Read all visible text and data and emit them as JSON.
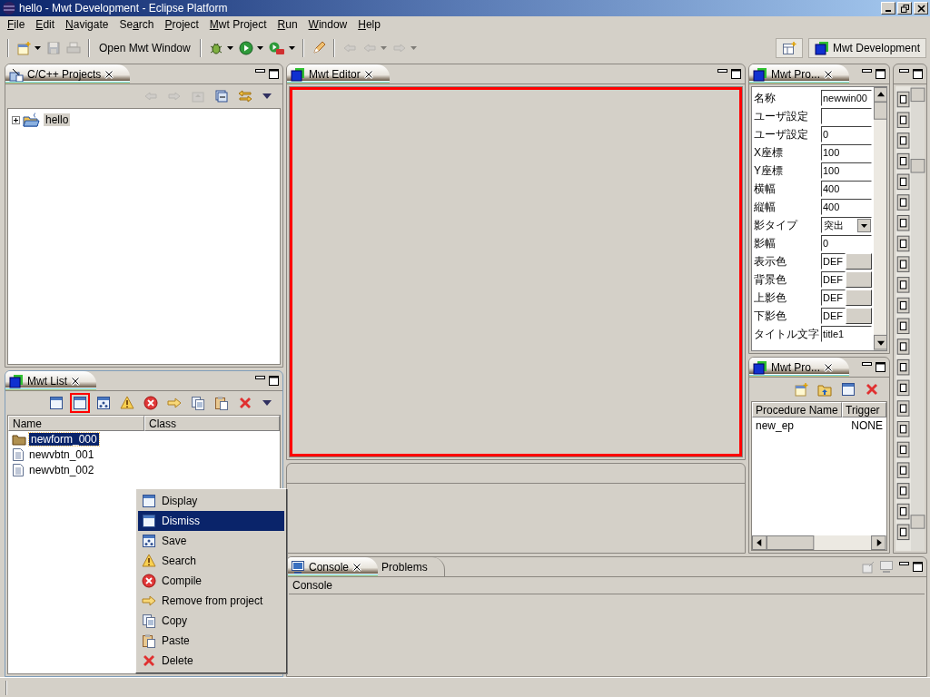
{
  "window": {
    "title": "hello - Mwt Development - Eclipse Platform"
  },
  "menu": [
    {
      "key": "F",
      "post": "ile"
    },
    {
      "key": "E",
      "post": "dit"
    },
    {
      "key": "N",
      "post": "avigate"
    },
    {
      "pre": "Se",
      "key": "a",
      "post": "rch"
    },
    {
      "key": "P",
      "post": "roject"
    },
    {
      "key": "M",
      "post": "wt Project"
    },
    {
      "key": "R",
      "post": "un"
    },
    {
      "key": "W",
      "post": "indow"
    },
    {
      "key": "H",
      "post": "elp"
    }
  ],
  "toolbar": {
    "items": [
      {
        "kind": "new",
        "dropdown": true,
        "disabled": false
      },
      {
        "kind": "save",
        "dropdown": false,
        "disabled": true
      },
      {
        "kind": "print",
        "dropdown": false,
        "disabled": true
      },
      {
        "kind": "separator"
      },
      {
        "kind": "text",
        "label": "Open Mwt Window"
      },
      {
        "kind": "separator"
      },
      {
        "kind": "debug",
        "dropdown": true,
        "disabled": false
      },
      {
        "kind": "run",
        "dropdown": true,
        "disabled": false
      },
      {
        "kind": "external",
        "dropdown": true,
        "disabled": false
      },
      {
        "kind": "separator"
      },
      {
        "kind": "tool",
        "dropdown": false,
        "disabled": false
      },
      {
        "kind": "separator"
      },
      {
        "kind": "last-edit",
        "dropdown": false,
        "disabled": true
      },
      {
        "kind": "back",
        "dropdown": true,
        "disabled": true
      },
      {
        "kind": "forward",
        "dropdown": true,
        "disabled": true
      }
    ],
    "perspective": "Mwt Development"
  },
  "projects_view": {
    "tab": "C/C++ Projects",
    "tools": [
      {
        "kind": "back",
        "disabled": true
      },
      {
        "kind": "forward",
        "disabled": true
      },
      {
        "kind": "up",
        "disabled": true
      },
      {
        "kind": "collapse",
        "disabled": false
      },
      {
        "kind": "link",
        "disabled": false
      },
      {
        "kind": "caret",
        "disabled": false
      }
    ],
    "tree": [
      {
        "label": "hello",
        "expanded": false,
        "selected": false
      }
    ]
  },
  "list_view": {
    "tab": "Mwt List",
    "tools": [
      {
        "kind": "window",
        "highlighted": false
      },
      {
        "kind": "window",
        "highlighted": true
      },
      {
        "kind": "save-dots",
        "highlighted": false
      },
      {
        "kind": "warning",
        "highlighted": false
      },
      {
        "kind": "error",
        "highlighted": false
      },
      {
        "kind": "arrow",
        "highlighted": false
      },
      {
        "kind": "copy",
        "highlighted": false
      },
      {
        "kind": "paste",
        "highlighted": false
      },
      {
        "kind": "delete",
        "highlighted": false
      },
      {
        "kind": "caret",
        "highlighted": false
      }
    ],
    "columns": [
      "Name",
      "Class"
    ],
    "rows": [
      {
        "name": "newform_000",
        "kind": "form",
        "selected": true
      },
      {
        "name": "newvbtn_001",
        "kind": "file",
        "selected": false
      },
      {
        "name": "newvbtn_002",
        "kind": "file",
        "selected": false
      }
    ]
  },
  "context_menu": [
    {
      "label": "Display",
      "kind": "window",
      "selected": false
    },
    {
      "label": "Dismiss",
      "kind": "window",
      "selected": true
    },
    {
      "label": "Save",
      "kind": "save-dots",
      "selected": false
    },
    {
      "label": "Search",
      "kind": "warning",
      "selected": false
    },
    {
      "label": "Compile",
      "kind": "error",
      "selected": false
    },
    {
      "label": "Remove from project",
      "kind": "arrow",
      "selected": false
    },
    {
      "label": "Copy",
      "kind": "copy",
      "selected": false
    },
    {
      "label": "Paste",
      "kind": "paste",
      "selected": false
    },
    {
      "label": "Delete",
      "kind": "delete",
      "selected": false
    }
  ],
  "editor": {
    "tab": "Mwt Editor",
    "form": {
      "selected": true
    }
  },
  "properties_view": {
    "tab": "Mwt Pro...",
    "rows": [
      {
        "label": "名称",
        "kind": "text",
        "value": "newwin00"
      },
      {
        "label": "ユーザ設定",
        "kind": "text"
      },
      {
        "label": "ユーザ設定",
        "kind": "text",
        "value": "0"
      },
      {
        "label": "X座標",
        "kind": "text",
        "value": "100"
      },
      {
        "label": "Y座標",
        "kind": "text",
        "value": "100"
      },
      {
        "label": "横幅",
        "kind": "text",
        "value": "400"
      },
      {
        "label": "縦幅",
        "kind": "text",
        "value": "400"
      },
      {
        "label": "影タイプ",
        "kind": "select",
        "value": "突出"
      },
      {
        "label": "影幅",
        "kind": "text",
        "value": "0"
      },
      {
        "label": "表示色",
        "kind": "color",
        "value": "DEF"
      },
      {
        "label": "背景色",
        "kind": "color",
        "value": "DEF"
      },
      {
        "label": "上影色",
        "kind": "color",
        "value": "DEF"
      },
      {
        "label": "下影色",
        "kind": "color",
        "value": "DEF"
      },
      {
        "label": "タイトル文字",
        "kind": "text",
        "value": "title1"
      }
    ]
  },
  "procedures_view": {
    "tab": "Mwt Pro...",
    "tools": [
      {
        "kind": "new"
      },
      {
        "kind": "open"
      },
      {
        "kind": "window"
      },
      {
        "kind": "delete"
      }
    ],
    "columns": [
      "Procedure Name",
      "Trigger"
    ],
    "rows": [
      [
        "new_ep",
        "NONE"
      ]
    ]
  },
  "console_view": {
    "tabs": [
      {
        "label": "Console",
        "selected": true
      },
      {
        "label": "Problems",
        "selected": false
      }
    ],
    "header": "Console"
  }
}
